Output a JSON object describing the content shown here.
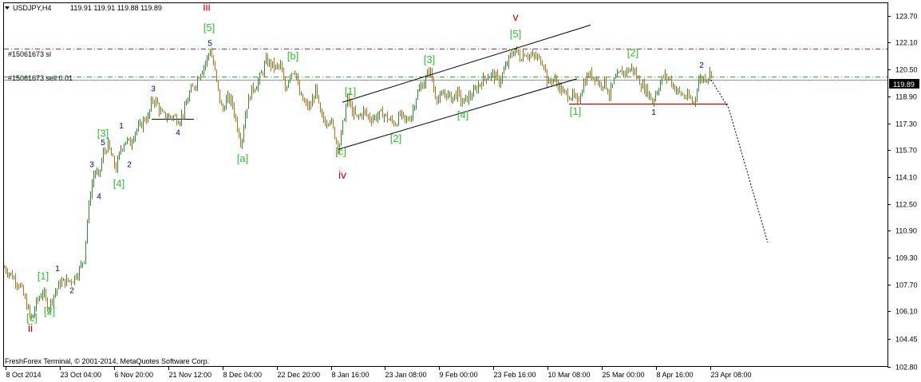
{
  "header": {
    "symbol": "USDJPY,H4",
    "ohlc": "119.91 119.91 119.88 119.89"
  },
  "copyright": "FreshForex Terminal, © 2001-2014, MetaQuotes Software Corp.",
  "order_lines": {
    "sl_label": "#15061673 sl",
    "sell_label": "#15061673 sell 0.01"
  },
  "current_price_label": "119.89",
  "colors": {
    "up_bar": "#2e8b2e",
    "down_bar": "#e06010",
    "wave_green": "#33bb33",
    "wave_red": "#cc0000",
    "wave_blue": "#000080",
    "sl_line": "#cc2244",
    "entry_line": "#33aa33",
    "support_line": "#cc0000"
  },
  "chart_data": {
    "type": "candlestick",
    "title": "USDJPY,H4",
    "y_ticks": [
      "123.70",
      "122.10",
      "120.50",
      "118.90",
      "117.30",
      "115.70",
      "114.10",
      "112.50",
      "110.90",
      "109.30",
      "107.70",
      "106.10",
      "104.45",
      "102.80"
    ],
    "x_ticks": [
      "8 Oct 2014",
      "23 Oct 04:00",
      "6 Nov 20:00",
      "21 Nov 12:00",
      "8 Dec 04:00",
      "22 Dec 20:00",
      "8 Jan 16:00",
      "23 Jan 08:00",
      "9 Feb 00:00",
      "23 Feb 16:00",
      "10 Mar 08:00",
      "25 Mar 00:00",
      "8 Apr 16:00",
      "23 Apr 08:00"
    ],
    "ylim": [
      102.8,
      124.45
    ],
    "sl_price": 121.75,
    "sell_price": 120.08,
    "last_price": 119.89,
    "support_price": 118.45,
    "price_path": [
      [
        0,
        108.7
      ],
      [
        10,
        108.2
      ],
      [
        20,
        107.6
      ],
      [
        28,
        106.5
      ],
      [
        34,
        105.6
      ],
      [
        40,
        106.6
      ],
      [
        48,
        107.3
      ],
      [
        55,
        106.3
      ],
      [
        62,
        107.1
      ],
      [
        70,
        107.8
      ],
      [
        78,
        107.9
      ],
      [
        86,
        108.0
      ],
      [
        94,
        108.6
      ],
      [
        100,
        109.3
      ],
      [
        104,
        111.5
      ],
      [
        108,
        113.2
      ],
      [
        113,
        114.5
      ],
      [
        118,
        114.1
      ],
      [
        124,
        115.5
      ],
      [
        130,
        116.0
      ],
      [
        135,
        115.2
      ],
      [
        140,
        114.6
      ],
      [
        146,
        115.8
      ],
      [
        152,
        116.3
      ],
      [
        158,
        116.1
      ],
      [
        163,
        116.8
      ],
      [
        170,
        117.1
      ],
      [
        176,
        117.6
      ],
      [
        180,
        117.6
      ],
      [
        185,
        118.7
      ],
      [
        190,
        118.6
      ],
      [
        197,
        117.8
      ],
      [
        204,
        117.7
      ],
      [
        212,
        117.7
      ],
      [
        219,
        117.5
      ],
      [
        226,
        118.1
      ],
      [
        232,
        119.1
      ],
      [
        238,
        119.5
      ],
      [
        246,
        120.4
      ],
      [
        252,
        120.9
      ],
      [
        258,
        121.7
      ],
      [
        263,
        120.6
      ],
      [
        268,
        119.2
      ],
      [
        273,
        118.0
      ],
      [
        279,
        118.8
      ],
      [
        285,
        118.6
      ],
      [
        291,
        117.3
      ],
      [
        297,
        116.1
      ],
      [
        303,
        118.2
      ],
      [
        310,
        119.3
      ],
      [
        316,
        119.6
      ],
      [
        322,
        120.2
      ],
      [
        328,
        121.0
      ],
      [
        334,
        120.8
      ],
      [
        340,
        120.6
      ],
      [
        346,
        120.7
      ],
      [
        352,
        119.3
      ],
      [
        358,
        120.3
      ],
      [
        364,
        120.5
      ],
      [
        370,
        119.0
      ],
      [
        376,
        118.5
      ],
      [
        383,
        118.2
      ],
      [
        390,
        119.3
      ],
      [
        396,
        117.8
      ],
      [
        402,
        117.4
      ],
      [
        408,
        117.6
      ],
      [
        414,
        116.6
      ],
      [
        419,
        115.8
      ],
      [
        424,
        117.2
      ],
      [
        430,
        118.8
      ],
      [
        436,
        118.0
      ],
      [
        442,
        117.6
      ],
      [
        450,
        118.0
      ],
      [
        458,
        117.6
      ],
      [
        466,
        117.7
      ],
      [
        474,
        117.9
      ],
      [
        482,
        117.5
      ],
      [
        490,
        117.3
      ],
      [
        496,
        117.8
      ],
      [
        503,
        117.4
      ],
      [
        510,
        117.8
      ],
      [
        516,
        118.9
      ],
      [
        522,
        119.5
      ],
      [
        528,
        119.9
      ],
      [
        533,
        120.6
      ],
      [
        539,
        119.1
      ],
      [
        545,
        118.7
      ],
      [
        552,
        119.1
      ],
      [
        560,
        118.8
      ],
      [
        568,
        119.1
      ],
      [
        574,
        118.5
      ],
      [
        580,
        118.8
      ],
      [
        588,
        119.1
      ],
      [
        596,
        119.7
      ],
      [
        604,
        120.1
      ],
      [
        612,
        120.2
      ],
      [
        620,
        119.8
      ],
      [
        627,
        120.5
      ],
      [
        633,
        121.2
      ],
      [
        640,
        121.7
      ],
      [
        646,
        121.2
      ],
      [
        652,
        121.5
      ],
      [
        660,
        121.3
      ],
      [
        668,
        121.2
      ],
      [
        676,
        120.9
      ],
      [
        681,
        119.6
      ],
      [
        687,
        120.0
      ],
      [
        694,
        119.6
      ],
      [
        700,
        119.1
      ],
      [
        707,
        119.0
      ],
      [
        713,
        118.9
      ],
      [
        718,
        118.5
      ],
      [
        725,
        119.6
      ],
      [
        732,
        120.2
      ],
      [
        740,
        120.1
      ],
      [
        746,
        119.6
      ],
      [
        752,
        119.8
      ],
      [
        758,
        119.0
      ],
      [
        764,
        119.8
      ],
      [
        772,
        120.3
      ],
      [
        780,
        120.4
      ],
      [
        787,
        120.6
      ],
      [
        793,
        120.0
      ],
      [
        800,
        119.5
      ],
      [
        806,
        119.2
      ],
      [
        812,
        118.6
      ],
      [
        818,
        119.3
      ],
      [
        826,
        120.1
      ],
      [
        834,
        119.9
      ],
      [
        840,
        119.4
      ],
      [
        846,
        119.1
      ],
      [
        852,
        118.9
      ],
      [
        858,
        118.8
      ],
      [
        864,
        118.5
      ],
      [
        870,
        119.9
      ],
      [
        876,
        120.0
      ],
      [
        882,
        120.1
      ],
      [
        886,
        120.4
      ]
    ],
    "projection": [
      [
        886,
        119.89
      ],
      [
        908,
        118.2
      ],
      [
        957,
        110.2
      ]
    ],
    "channel_upper": [
      [
        424,
        118.55
      ],
      [
        735,
        123.15
      ]
    ],
    "channel_lower": [
      [
        419,
        115.75
      ],
      [
        718,
        119.95
      ]
    ],
    "wave_labels": [
      {
        "text": "ii",
        "t": 33,
        "price": 104.9,
        "color": "red",
        "size": 14
      },
      {
        "text": "[c]",
        "t": 35,
        "price": 105.5,
        "color": "green",
        "size": 13
      },
      {
        "text": "[1]",
        "t": 49,
        "price": 108.0,
        "color": "green",
        "size": 13
      },
      {
        "text": "[2]",
        "t": 57,
        "price": 105.9,
        "color": "green",
        "size": 13
      },
      {
        "text": "1",
        "t": 67,
        "price": 108.5,
        "color": "blue",
        "size": 10
      },
      {
        "text": "2",
        "t": 85,
        "price": 107.2,
        "color": "blue",
        "size": 10
      },
      {
        "text": "3",
        "t": 110,
        "price": 114.7,
        "color": "blue",
        "size": 10
      },
      {
        "text": "4",
        "t": 119,
        "price": 112.8,
        "color": "blue",
        "size": 10
      },
      {
        "text": "5",
        "t": 124,
        "price": 116.0,
        "color": "blue",
        "size": 10
      },
      {
        "text": "[3]",
        "t": 124,
        "price": 116.5,
        "color": "green",
        "size": 13
      },
      {
        "text": "[4]",
        "t": 144,
        "price": 113.5,
        "color": "green",
        "size": 13
      },
      {
        "text": "1",
        "t": 147,
        "price": 117.0,
        "color": "blue",
        "size": 10
      },
      {
        "text": "2",
        "t": 157,
        "price": 114.7,
        "color": "blue",
        "size": 10
      },
      {
        "text": "3",
        "t": 187,
        "price": 119.2,
        "color": "blue",
        "size": 10
      },
      {
        "text": "4",
        "t": 218,
        "price": 116.6,
        "color": "blue",
        "size": 10
      },
      {
        "text": "iii",
        "t": 254,
        "price": 124.0,
        "color": "red",
        "size": 14
      },
      {
        "text": "[5]",
        "t": 257,
        "price": 122.8,
        "color": "green",
        "size": 13
      },
      {
        "text": "5",
        "t": 258,
        "price": 121.9,
        "color": "blue",
        "size": 10
      },
      {
        "text": "[a]",
        "t": 299,
        "price": 115.0,
        "color": "green",
        "size": 13
      },
      {
        "text": "[b]",
        "t": 362,
        "price": 121.1,
        "color": "green",
        "size": 13
      },
      {
        "text": "[c]",
        "t": 422,
        "price": 115.4,
        "color": "green",
        "size": 13
      },
      {
        "text": "iv",
        "t": 424,
        "price": 114.0,
        "color": "red",
        "size": 14
      },
      {
        "text": "[1]",
        "t": 434,
        "price": 119.0,
        "color": "green",
        "size": 13
      },
      {
        "text": "[2]",
        "t": 491,
        "price": 116.2,
        "color": "green",
        "size": 13
      },
      {
        "text": "[3]",
        "t": 533,
        "price": 120.9,
        "color": "green",
        "size": 13
      },
      {
        "text": "[4]",
        "t": 575,
        "price": 117.6,
        "color": "green",
        "size": 13
      },
      {
        "text": "v",
        "t": 641,
        "price": 123.4,
        "color": "red",
        "size": 14
      },
      {
        "text": "[5]",
        "t": 641,
        "price": 122.4,
        "color": "green",
        "size": 13
      },
      {
        "text": "[1]",
        "t": 716,
        "price": 117.8,
        "color": "green",
        "size": 13
      },
      {
        "text": "[2]",
        "t": 788,
        "price": 121.3,
        "color": "green",
        "size": 13
      },
      {
        "text": "1",
        "t": 814,
        "price": 117.8,
        "color": "blue",
        "size": 10
      },
      {
        "text": "2",
        "t": 874,
        "price": 120.6,
        "color": "blue",
        "size": 10
      }
    ]
  }
}
